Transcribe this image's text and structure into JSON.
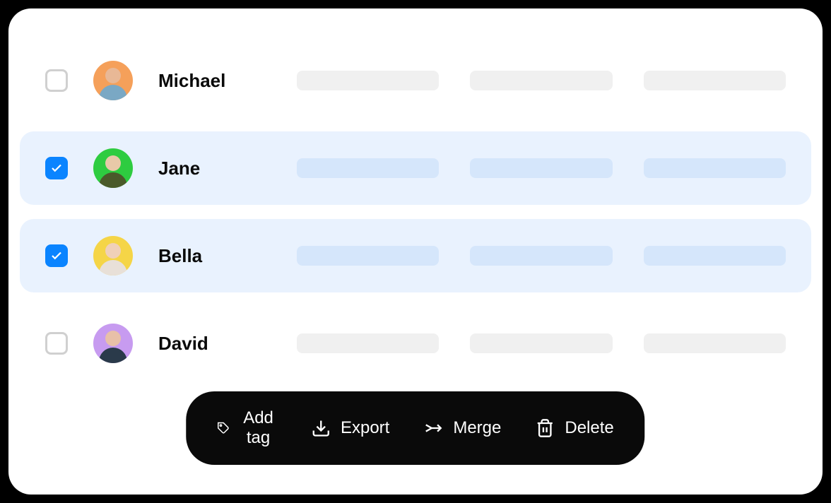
{
  "rows": [
    {
      "name": "Michael",
      "selected": false,
      "avatar_bg": "#f5a05a",
      "avatar_head": "#e8b896",
      "avatar_body": "#7aa8c4"
    },
    {
      "name": "Jane",
      "selected": true,
      "avatar_bg": "#2ecc40",
      "avatar_head": "#e8c9a8",
      "avatar_body": "#4a5a2a"
    },
    {
      "name": "Bella",
      "selected": true,
      "avatar_bg": "#f5d547",
      "avatar_head": "#f0d0b8",
      "avatar_body": "#e8e0d8"
    },
    {
      "name": "David",
      "selected": false,
      "avatar_bg": "#c79bf0",
      "avatar_head": "#e8c0a8",
      "avatar_body": "#2a3a4a"
    }
  ],
  "toolbar": {
    "add_tag": "Add tag",
    "export": "Export",
    "merge": "Merge",
    "delete": "Delete"
  }
}
